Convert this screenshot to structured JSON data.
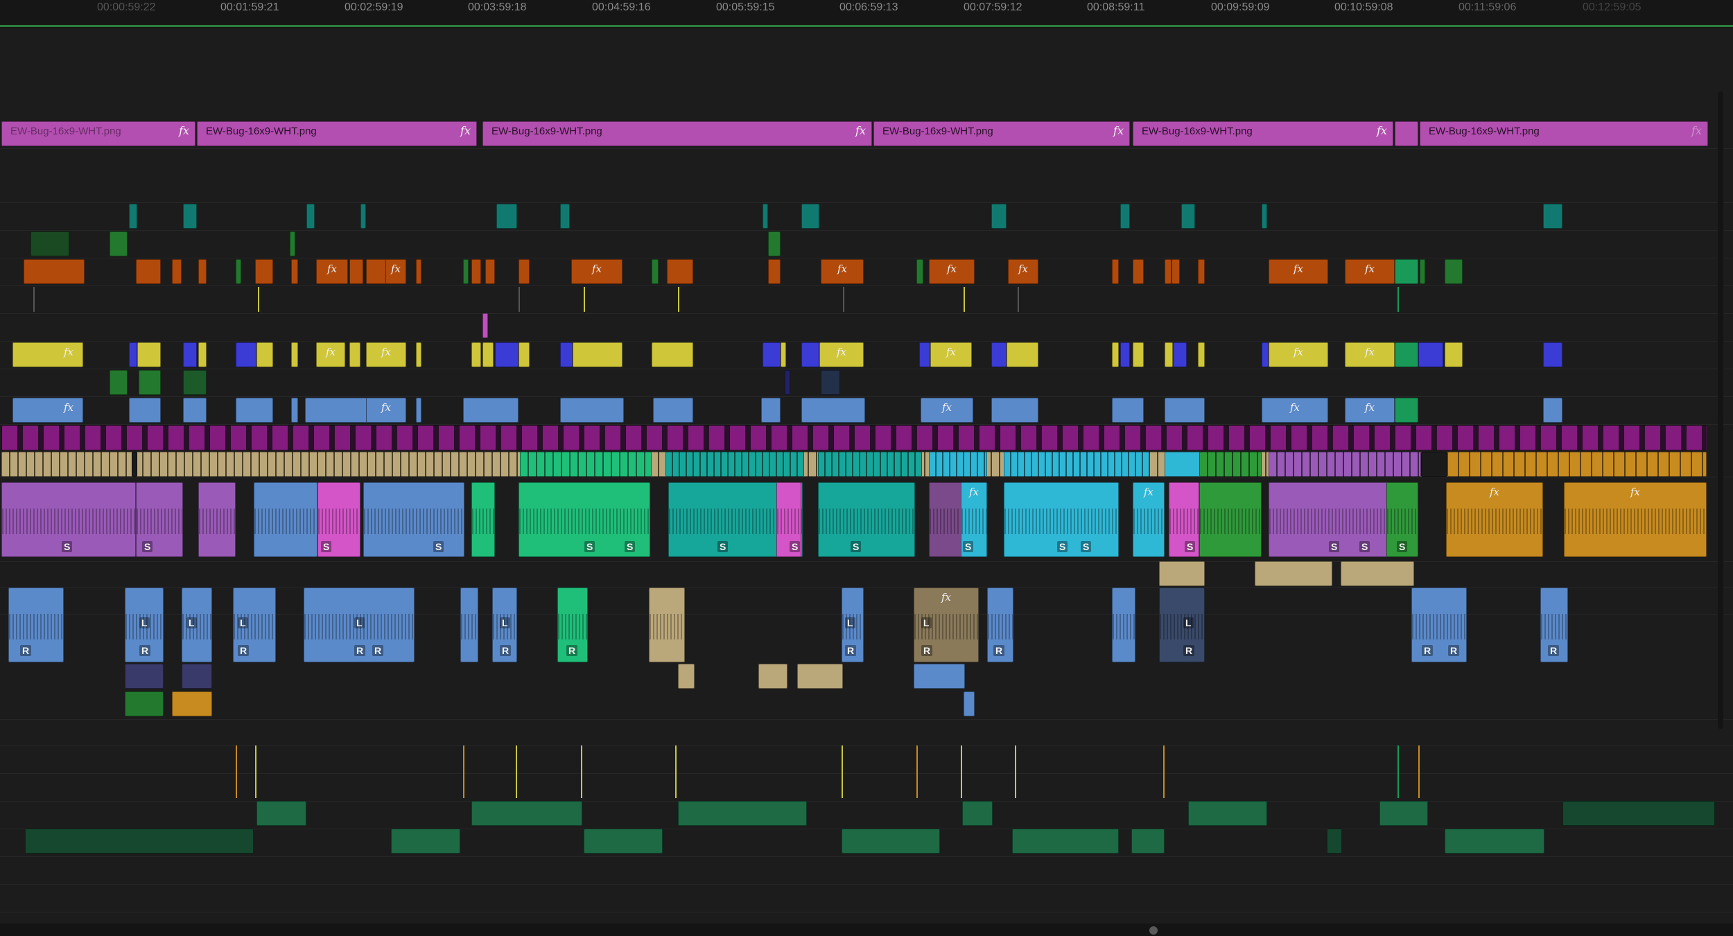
{
  "ruler": {
    "timecodes": [
      "00:00:59:22",
      "00:01:59:21",
      "00:02:59:19",
      "00:03:59:18",
      "00:04:59:16",
      "00:05:59:15",
      "00:06:59:13",
      "00:07:59:12",
      "00:08:59:11",
      "00:09:59:09",
      "00:10:59:08",
      "00:11:59:06",
      "00:12:59:05"
    ]
  },
  "graphics_track": {
    "clip_name": "EW-Bug-16x9-WHT.png",
    "fx_label": "fx",
    "color": "#b34fb0"
  },
  "audio": {
    "left_label": "L",
    "right_label": "R",
    "solo_label": "S"
  },
  "colors": {
    "teal": "#117a70",
    "orange": "#b24a0c",
    "green": "#237a2e",
    "yellow": "#cfc63a",
    "blue": "#3b3bd6",
    "steel": "#5b8acb",
    "magenta": "#8a1b84",
    "tan": "#bba87a",
    "cyan": "#2fb7d6",
    "emerald": "#1fbf7a",
    "pink": "#d455c8",
    "violet": "#9a5ab8",
    "amber": "#c78b1f",
    "darkgreen": "#1d6a45",
    "playbar": "#2b7f3d"
  }
}
